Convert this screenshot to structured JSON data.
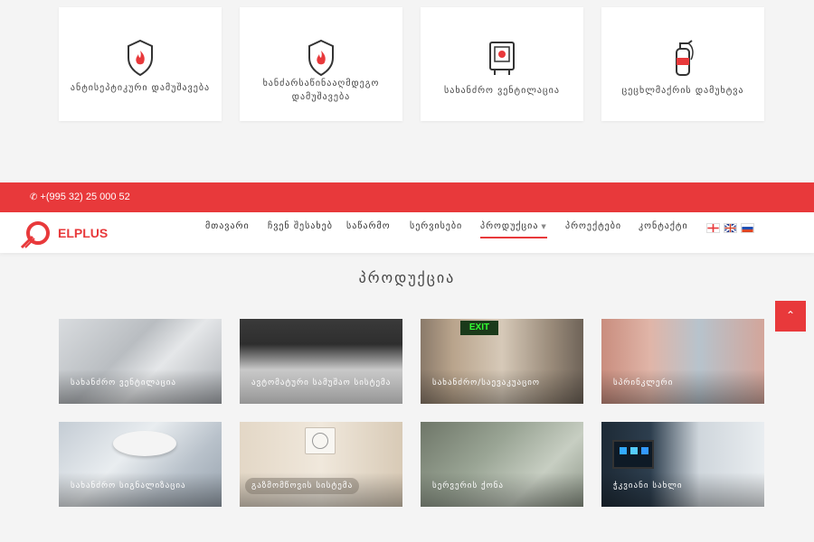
{
  "services": [
    {
      "label": "ანტისეპტიკური დამუშავება",
      "icon": "shield-flame-icon"
    },
    {
      "label": "ხანძარსაწინააღმდეგო დამუშავება",
      "icon": "shield-flame-icon"
    },
    {
      "label": "სახანძრო ვენტილაცია",
      "icon": "fire-valve-icon"
    },
    {
      "label": "ცეცხლმაქრის დამუხტვა",
      "icon": "fire-extinguisher-icon"
    }
  ],
  "topbar": {
    "phone": "+(995 32) 25 000 52",
    "phone_icon": "phone-icon"
  },
  "brand": {
    "logo_text": "ELPLUS",
    "accent": "#e8393b"
  },
  "nav": {
    "items": [
      "მთავარი",
      "ჩვენ შესახებ",
      "საწარმო",
      "სერვისები",
      "პროდუქცია",
      "პროექტები",
      "კონტაქტი"
    ],
    "active": "პროდუქცია",
    "flags": [
      "georgia-flag-icon",
      "uk-flag-icon",
      "russia-flag-icon"
    ]
  },
  "products": {
    "title": "პროდუქცია",
    "items": [
      "სახანძრო ვენტილაცია",
      "ავტომატური სამუშაო სისტემა",
      "სახანძრო/საევაკუაციო",
      "სპრინკლერი",
      "სახანძრო სიგნალიზაცია",
      "გაზმომწოვის სისტემა",
      "სერვერის ქონა",
      "ჭკვიანი სახლი"
    ]
  },
  "scroll_top": {
    "label": "⌃"
  }
}
